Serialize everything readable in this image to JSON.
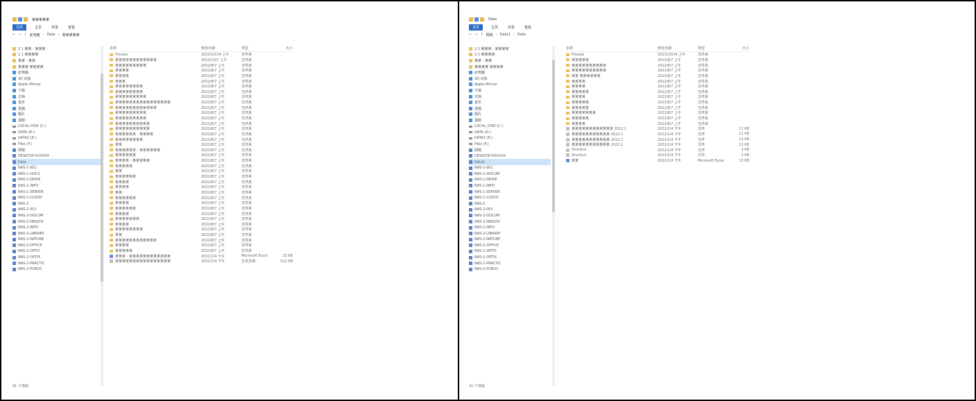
{
  "left_window": {
    "title": "某某某某某",
    "ribbon_tabs": [
      "文件",
      "主页",
      "共享",
      "查看"
    ],
    "breadcrumb": [
      "此电脑",
      "Data",
      "某某某某某"
    ],
    "sidebar": [
      {
        "label": "2.1 某某 - 某某某",
        "icon": "folder"
      },
      {
        "label": "2.1 某某某某",
        "icon": "folder"
      },
      {
        "label": "某某 - 某某",
        "icon": "folder"
      },
      {
        "label": "某某某 某某某某",
        "icon": "folder"
      },
      {
        "label": "此电脑",
        "icon": "pc"
      },
      {
        "label": "3D 对象",
        "icon": "pc"
      },
      {
        "label": "Apple iPhone",
        "icon": "pc"
      },
      {
        "label": "下载",
        "icon": "pc"
      },
      {
        "label": "文档",
        "icon": "pc"
      },
      {
        "label": "音乐",
        "icon": "pc"
      },
      {
        "label": "桌面",
        "icon": "pc"
      },
      {
        "label": "图片",
        "icon": "pc"
      },
      {
        "label": "视频",
        "icon": "pc"
      },
      {
        "label": "LOCAL-DISK (C:)",
        "icon": "drive"
      },
      {
        "label": "DATA (D:)",
        "icon": "drive"
      },
      {
        "label": "DATA2 (E:)",
        "icon": "drive"
      },
      {
        "label": "Files (F:)",
        "icon": "drive"
      },
      {
        "label": "网络",
        "icon": "net"
      },
      {
        "label": "DESKTOP-XXXXXX",
        "icon": "net"
      },
      {
        "label": "Data",
        "icon": "net",
        "selected": true
      },
      {
        "label": "NAS-1-001",
        "icon": "net"
      },
      {
        "label": "NAS-1-DOCS",
        "icon": "net"
      },
      {
        "label": "NAS-1-DRIVE",
        "icon": "net"
      },
      {
        "label": "NAS-1-INFO",
        "icon": "net"
      },
      {
        "label": "NAS-1-SERVER",
        "icon": "net"
      },
      {
        "label": "NAS-1-CLOUD",
        "icon": "net"
      },
      {
        "label": "NAS-2",
        "icon": "net"
      },
      {
        "label": "NAS-2-001",
        "icon": "net"
      },
      {
        "label": "NAS-2-DOCUM",
        "icon": "net"
      },
      {
        "label": "NAS-2-HEALTH",
        "icon": "net"
      },
      {
        "label": "NAS-2-INFO",
        "icon": "net"
      },
      {
        "label": "NAS-2-LIBRARY",
        "icon": "net"
      },
      {
        "label": "NAS-2-NATURE",
        "icon": "net"
      },
      {
        "label": "NAS-2-OFFICE",
        "icon": "net"
      },
      {
        "label": "NAS-2-OPTIC",
        "icon": "net"
      },
      {
        "label": "NAS-2-OPTIX",
        "icon": "net"
      },
      {
        "label": "NAS-2-PRACTIC",
        "icon": "net"
      },
      {
        "label": "NAS-2-PUBLIC",
        "icon": "net"
      }
    ],
    "columns": [
      "名称",
      "修改日期",
      "类型",
      "大小"
    ],
    "rows": [
      {
        "name": "Presale",
        "date": "2022/10/14 上午",
        "type": "文件夹",
        "size": ""
      },
      {
        "name": "某某某某某某某某某某某某",
        "date": "2022/10/7 上午",
        "type": "文件夹",
        "size": ""
      },
      {
        "name": "某某某某某某某某某",
        "date": "2022/8/7 上午",
        "type": "文件夹",
        "size": ""
      },
      {
        "name": "某某某某",
        "date": "2022/8/7 上午",
        "type": "文件夹",
        "size": ""
      },
      {
        "name": "某某某某",
        "date": "2022/8/7 上午",
        "type": "文件夹",
        "size": ""
      },
      {
        "name": "某某某",
        "date": "2022/8/7 上午",
        "type": "文件夹",
        "size": ""
      },
      {
        "name": "某某某某某某某某",
        "date": "2022/8/7 上午",
        "type": "文件夹",
        "size": ""
      },
      {
        "name": "某某某某某某某某",
        "date": "2022/8/7 上午",
        "type": "文件夹",
        "size": ""
      },
      {
        "name": "某某某某某某某某某",
        "date": "2022/8/7 上午",
        "type": "文件夹",
        "size": ""
      },
      {
        "name": "某某某某某某某某某某某某某某某某",
        "date": "2022/8/7 上午",
        "type": "文件夹",
        "size": ""
      },
      {
        "name": "某某某某某某某某某某某某",
        "date": "2022/8/7 上午",
        "type": "文件夹",
        "size": ""
      },
      {
        "name": "某某某某某某某某某",
        "date": "2022/8/7 上午",
        "type": "文件夹",
        "size": ""
      },
      {
        "name": "某某某某某某某某某",
        "date": "2022/8/7 上午",
        "type": "文件夹",
        "size": ""
      },
      {
        "name": "某某某某某某某某某某",
        "date": "2022/8/7 上午",
        "type": "文件夹",
        "size": ""
      },
      {
        "name": "某某某某某某某某某某",
        "date": "2022/8/7 上午",
        "type": "文件夹",
        "size": ""
      },
      {
        "name": "某某某某某某 - 某某某某",
        "date": "2022/8/7 上午",
        "type": "文件夹",
        "size": ""
      },
      {
        "name": "某某某某某某某某",
        "date": "2022/8/7 上午",
        "type": "文件夹",
        "size": ""
      },
      {
        "name": "某某",
        "date": "2022/8/7 上午",
        "type": "文件夹",
        "size": ""
      },
      {
        "name": "某某某某某某 - 某某某某某某",
        "date": "2022/8/7 上午",
        "type": "文件夹",
        "size": ""
      },
      {
        "name": "某某某某某某",
        "date": "2022/8/7 上午",
        "type": "文件夹",
        "size": ""
      },
      {
        "name": "某某某某 - 某某某某某",
        "date": "2022/8/7 上午",
        "type": "文件夹",
        "size": ""
      },
      {
        "name": "某某某某某",
        "date": "2022/8/7 上午",
        "type": "文件夹",
        "size": ""
      },
      {
        "name": "某某",
        "date": "2022/8/7 上午",
        "type": "文件夹",
        "size": ""
      },
      {
        "name": "某某某某某某",
        "date": "2022/8/7 上午",
        "type": "文件夹",
        "size": ""
      },
      {
        "name": "某某某某",
        "date": "2022/8/7 上午",
        "type": "文件夹",
        "size": ""
      },
      {
        "name": "某某某某",
        "date": "2022/8/7 上午",
        "type": "文件夹",
        "size": ""
      },
      {
        "name": "某某",
        "date": "2022/8/7 上午",
        "type": "文件夹",
        "size": ""
      },
      {
        "name": "某某某某某某",
        "date": "2022/8/7 上午",
        "type": "文件夹",
        "size": ""
      },
      {
        "name": "某某某某",
        "date": "2022/8/7 上午",
        "type": "文件夹",
        "size": ""
      },
      {
        "name": "某某某某某某",
        "date": "2022/8/7 上午",
        "type": "文件夹",
        "size": ""
      },
      {
        "name": "某某某某",
        "date": "2022/8/7 上午",
        "type": "文件夹",
        "size": ""
      },
      {
        "name": "某某某某某某某",
        "date": "2022/8/7 上午",
        "type": "文件夹",
        "size": ""
      },
      {
        "name": "某某某某",
        "date": "2022/8/7 上午",
        "type": "文件夹",
        "size": ""
      },
      {
        "name": "某某某某某某某某",
        "date": "2022/8/7 上午",
        "type": "文件夹",
        "size": ""
      },
      {
        "name": "某某",
        "date": "2022/8/7 上午",
        "type": "文件夹",
        "size": ""
      },
      {
        "name": "某某某某某某某某某某某某",
        "date": "2022/8/7 上午",
        "type": "文件夹",
        "size": ""
      },
      {
        "name": "某某某某",
        "date": "2022/8/7 上午",
        "type": "文件夹",
        "size": ""
      },
      {
        "name": "某某某某某",
        "date": "2022/8/7 上午",
        "type": "文件夹",
        "size": ""
      },
      {
        "name": "某某某 - 某某某某某某某某某某某某",
        "date": "2022/1/4 下午",
        "type": "Microsoft Excel",
        "size": "23 KB",
        "icon": "doc"
      },
      {
        "name": "某某某某某某某某某某某某某某某某",
        "date": "2022/1/4 下午",
        "type": "文本文档",
        "size": "512 KB",
        "icon": "txt"
      }
    ],
    "status": "41 个项目"
  },
  "right_window": {
    "title": "Data",
    "ribbon_tabs": [
      "文件",
      "主页",
      "共享",
      "查看"
    ],
    "breadcrumb": [
      "网络",
      "Data1",
      "Data"
    ],
    "sidebar": [
      {
        "label": "2.1 某某某 - 某某某某",
        "icon": "folder"
      },
      {
        "label": "2.1 某某某某",
        "icon": "folder"
      },
      {
        "label": "某某 - 某某",
        "icon": "folder"
      },
      {
        "label": "某某某某 某某某某",
        "icon": "folder"
      },
      {
        "label": "此电脑",
        "icon": "pc"
      },
      {
        "label": "3D 对象",
        "icon": "pc"
      },
      {
        "label": "Apple iPhone",
        "icon": "pc"
      },
      {
        "label": "下载",
        "icon": "pc"
      },
      {
        "label": "文档",
        "icon": "pc"
      },
      {
        "label": "音乐",
        "icon": "pc"
      },
      {
        "label": "桌面",
        "icon": "pc"
      },
      {
        "label": "图片",
        "icon": "pc"
      },
      {
        "label": "视频",
        "icon": "pc"
      },
      {
        "label": "LOCAL_DISK (C:)",
        "icon": "drive"
      },
      {
        "label": "DATA (D:)",
        "icon": "drive"
      },
      {
        "label": "DATA2 (E:)",
        "icon": "drive"
      },
      {
        "label": "Files (F:)",
        "icon": "drive"
      },
      {
        "label": "网络",
        "icon": "net"
      },
      {
        "label": "DESKTOP-XXXXXX",
        "icon": "net"
      },
      {
        "label": "Data1",
        "icon": "net",
        "selected": true
      },
      {
        "label": "NAS-1-001",
        "icon": "net"
      },
      {
        "label": "NAS-1-DOCUM",
        "icon": "net"
      },
      {
        "label": "NAS-1-DRIVE",
        "icon": "net"
      },
      {
        "label": "NAS-1-INFO",
        "icon": "net"
      },
      {
        "label": "NAS-1-SERVER",
        "icon": "net"
      },
      {
        "label": "NAS-1-CLOUD",
        "icon": "net"
      },
      {
        "label": "NAS-2",
        "icon": "net"
      },
      {
        "label": "NAS-2-001",
        "icon": "net"
      },
      {
        "label": "NAS-2-DOCUM",
        "icon": "net"
      },
      {
        "label": "NAS-2-HEALTH",
        "icon": "net"
      },
      {
        "label": "NAS-2-INFO",
        "icon": "net"
      },
      {
        "label": "NAS-2-LIBRARY",
        "icon": "net"
      },
      {
        "label": "NAS-2-NATURE",
        "icon": "net"
      },
      {
        "label": "NAS-2-OFFICE",
        "icon": "net"
      },
      {
        "label": "NAS-2-OPTIC",
        "icon": "net"
      },
      {
        "label": "NAS-2-OPTIX",
        "icon": "net"
      },
      {
        "label": "NAS-2-PRACTIC",
        "icon": "net"
      },
      {
        "label": "NAS-2-PUBLIC",
        "icon": "net"
      }
    ],
    "columns": [
      "名称",
      "修改日期",
      "类型",
      "大小"
    ],
    "rows": [
      {
        "name": "Presale",
        "date": "2022/10/14 上午",
        "type": "文件夹",
        "size": ""
      },
      {
        "name": "某某某某某",
        "date": "2022/8/7 上午",
        "type": "文件夹",
        "size": ""
      },
      {
        "name": "某某某某某某某某某某",
        "date": "2022/8/7 上午",
        "type": "文件夹",
        "size": ""
      },
      {
        "name": "某某某某某某某某某某",
        "date": "2022/8/7 上午",
        "type": "文件夹",
        "size": ""
      },
      {
        "name": "某某 某某某某某某",
        "date": "2022/8/7 上午",
        "type": "文件夹",
        "size": ""
      },
      {
        "name": "某某某某",
        "date": "2022/8/7 上午",
        "type": "文件夹",
        "size": ""
      },
      {
        "name": "某某某某",
        "date": "2022/8/7 上午",
        "type": "文件夹",
        "size": ""
      },
      {
        "name": "某某某某某",
        "date": "2022/8/7 上午",
        "type": "文件夹",
        "size": ""
      },
      {
        "name": "某某某某",
        "date": "2022/8/7 上午",
        "type": "文件夹",
        "size": ""
      },
      {
        "name": "某某某某某",
        "date": "2022/8/7 上午",
        "type": "文件夹",
        "size": ""
      },
      {
        "name": "某某某某某",
        "date": "2022/8/7 上午",
        "type": "文件夹",
        "size": ""
      },
      {
        "name": "某某某某某某某",
        "date": "2022/8/7 上午",
        "type": "文件夹",
        "size": ""
      },
      {
        "name": "某某某某某",
        "date": "2022/8/7 上午",
        "type": "文件夹",
        "size": ""
      },
      {
        "name": "某某某某",
        "date": "2022/8/7 上午",
        "type": "文件夹",
        "size": ""
      },
      {
        "name": "某某某某某某某某某某某某 2022.1",
        "date": "2022/1/4 下午",
        "type": "文件",
        "size": "11 KB",
        "icon": "txt"
      },
      {
        "name": "某某某某某某某某某某某 2022.1",
        "date": "2022/1/4 下午",
        "type": "文件",
        "size": "11 KB",
        "icon": "txt"
      },
      {
        "name": "某某某某某某某某某某某 2022.2",
        "date": "2022/1/4 下午",
        "type": "文件",
        "size": "11 KB",
        "icon": "txt"
      },
      {
        "name": "某某某某某某某某某某某 2022.2",
        "date": "2022/1/4 下午",
        "type": "文件",
        "size": "11 KB",
        "icon": "txt"
      },
      {
        "name": "Shortcut",
        "date": "2022/1/4 下午",
        "type": "文件",
        "size": "2 KB",
        "icon": "txt"
      },
      {
        "name": "Shortcut",
        "date": "2022/1/4 下午",
        "type": "文件",
        "size": "2 KB",
        "icon": "txt"
      },
      {
        "name": "某某",
        "date": "2022/1/4 下午",
        "type": "Microsoft Excel",
        "size": "13 KB",
        "icon": "doc"
      }
    ],
    "status": "21 个项目"
  }
}
